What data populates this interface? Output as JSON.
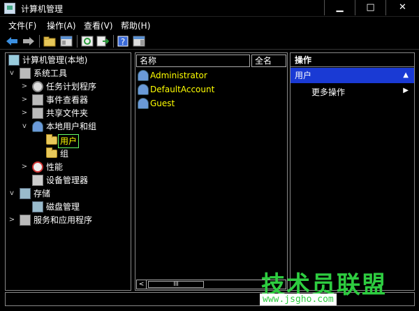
{
  "window": {
    "title": "计算机管理",
    "controls": [
      "▁",
      "□",
      "✕"
    ]
  },
  "menu": [
    "文件(F)",
    "操作(A)",
    "查看(V)",
    "帮助(H)"
  ],
  "tree": [
    {
      "label": "计算机管理(本地)",
      "icon": "computer-icon",
      "chev": ""
    },
    {
      "label": "系统工具",
      "icon": "tools-icon",
      "chev": "v"
    },
    {
      "label": "任务计划程序",
      "icon": "clock-icon",
      "chev": ">"
    },
    {
      "label": "事件查看器",
      "icon": "event-viewer-icon",
      "chev": ">"
    },
    {
      "label": "共享文件夹",
      "icon": "shared-folder-icon",
      "chev": ">"
    },
    {
      "label": "本地用户和组",
      "icon": "users-icon",
      "chev": "v"
    },
    {
      "label": "用户",
      "icon": "folder-icon",
      "chev": ""
    },
    {
      "label": "组",
      "icon": "folder-icon",
      "chev": ""
    },
    {
      "label": "性能",
      "icon": "performance-icon",
      "chev": ">"
    },
    {
      "label": "设备管理器",
      "icon": "device-manager-icon",
      "chev": ""
    },
    {
      "label": "存储",
      "icon": "storage-icon",
      "chev": "v"
    },
    {
      "label": "磁盘管理",
      "icon": "disk-icon",
      "chev": ""
    },
    {
      "label": "服务和应用程序",
      "icon": "services-icon",
      "chev": ">"
    }
  ],
  "list": {
    "columns": [
      "名称",
      "全名"
    ],
    "rows": [
      "Administrator",
      "DefaultAccount",
      "Guest"
    ],
    "scroll_thumb": "III",
    "scroll_left": "<"
  },
  "actions": {
    "header": "操作",
    "selected": "用户",
    "selected_caret": "▲",
    "more": "更多操作",
    "more_arrow": "▶"
  },
  "watermark": {
    "title": "技术员联盟",
    "url": "www.jsgho.com"
  },
  "colors": {
    "accent": "#1a3ad4",
    "selected_text": "#ffff00",
    "watermark": "#2ecc40"
  }
}
